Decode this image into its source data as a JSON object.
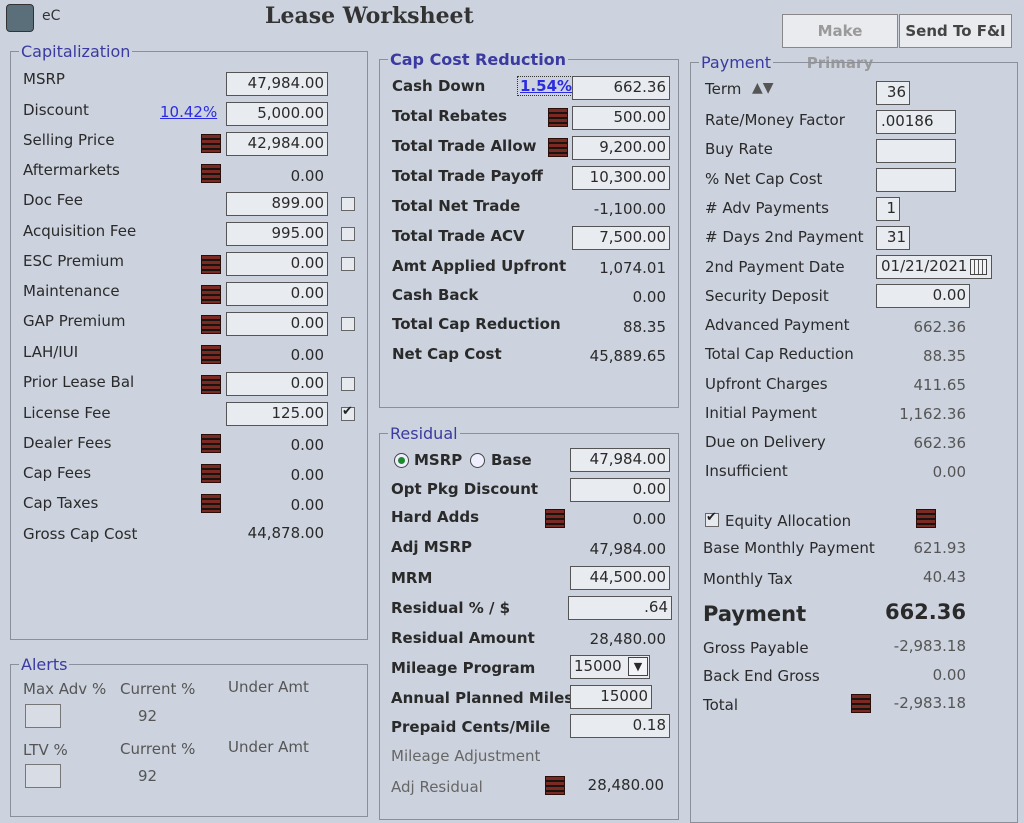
{
  "app": {
    "title": "Lease Worksheet",
    "brand": "eC"
  },
  "toolbar": {
    "make_primary": "Make Primary",
    "send_fi": "Send To F&I"
  },
  "capitalization": {
    "legend": "Capitalization",
    "msrp_label": "MSRP",
    "msrp": "47,984.00",
    "discount_label": "Discount",
    "discount_pct": "10.42%",
    "discount": "5,000.00",
    "selling_label": "Selling Price",
    "selling": "42,984.00",
    "aftermarkets_label": "Aftermarkets",
    "aftermarkets": "0.00",
    "docfee_label": "Doc Fee",
    "docfee": "899.00",
    "acqfee_label": "Acquisition Fee",
    "acqfee": "995.00",
    "esc_label": "ESC Premium",
    "esc": "0.00",
    "maint_label": "Maintenance",
    "maint": "0.00",
    "gap_label": "GAP Premium",
    "gap": "0.00",
    "lah_label": "LAH/IUI",
    "lah": "0.00",
    "prior_label": "Prior Lease Bal",
    "prior": "0.00",
    "license_label": "License Fee",
    "license": "125.00",
    "dealer_label": "Dealer Fees",
    "dealer": "0.00",
    "capfees_label": "Cap Fees",
    "capfees": "0.00",
    "captaxes_label": "Cap Taxes",
    "captaxes": "0.00",
    "gross_label": "Gross Cap Cost",
    "gross": "44,878.00"
  },
  "alerts": {
    "legend": "Alerts",
    "maxadv_label": "Max Adv %",
    "current_label": "Current %",
    "under_label": "Under Amt",
    "maxadv_current": "92",
    "ltv_label": "LTV %",
    "ltv_current_label": "Current %",
    "ltv_under_label": "Under Amt",
    "ltv_current": "92"
  },
  "capcost": {
    "legend": "Cap Cost Reduction",
    "cashdown_label": "Cash Down",
    "cashdown_pct": "1.54%",
    "cashdown": "662.36",
    "rebates_label": "Total Rebates",
    "rebates": "500.00",
    "tradeallow_label": "Total Trade Allow",
    "tradeallow": "9,200.00",
    "payoff_label": "Total Trade Payoff",
    "payoff": "10,300.00",
    "nettrade_label": "Total Net Trade",
    "nettrade": "-1,100.00",
    "acv_label": "Total Trade ACV",
    "acv": "7,500.00",
    "applied_label": "Amt Applied Upfront",
    "applied": "1,074.01",
    "cashback_label": "Cash Back",
    "cashback": "0.00",
    "totalred_label": "Total Cap Reduction",
    "totalred": "88.35",
    "netcap_label": "Net Cap Cost",
    "netcap": "45,889.65"
  },
  "residual": {
    "legend": "Residual",
    "msrp_radio": "MSRP",
    "base_radio": "Base",
    "msrp": "47,984.00",
    "optpkg_label": "Opt Pkg Discount",
    "optpkg": "0.00",
    "hardadds_label": "Hard Adds",
    "hardadds": "0.00",
    "adjmsrp_label": "Adj MSRP",
    "adjmsrp": "47,984.00",
    "mrm_label": "MRM",
    "mrm": "44,500.00",
    "respct_label": "Residual % / $",
    "respct": ".64",
    "resamt_label": "Residual Amount",
    "resamt": "28,480.00",
    "mileage_label": "Mileage Program",
    "mileage": "15000",
    "annual_label": "Annual Planned Miles",
    "annual": "15000",
    "prepaid_label": "Prepaid Cents/Mile",
    "prepaid": "0.18",
    "mileadj_label": "Mileage Adjustment",
    "adjres_label": "Adj Residual",
    "adjres": "28,480.00"
  },
  "payment": {
    "legend": "Payment",
    "term_label": "Term",
    "term": "36",
    "rate_label": "Rate/Money Factor",
    "rate": ".00186",
    "buyrate_label": "Buy Rate",
    "buyrate": "",
    "netcap_label": "% Net Cap Cost",
    "netcap": "",
    "adv_label": "# Adv Payments",
    "adv": "1",
    "days_label": "# Days 2nd Payment",
    "days": "31",
    "date_label": "2nd Payment Date",
    "date": "01/21/2021",
    "security_label": "Security Deposit",
    "security": "0.00",
    "advpay_label": "Advanced Payment",
    "advpay": "662.36",
    "capred_label": "Total Cap Reduction",
    "capred": "88.35",
    "upfront_label": "Upfront Charges",
    "upfront": "411.65",
    "initial_label": "Initial Payment",
    "initial": "1,162.36",
    "due_label": "Due on Delivery",
    "due": "662.36",
    "insuff_label": "Insufficient",
    "insuff": "0.00",
    "equity_label": "Equity Allocation",
    "base_label": "Base Monthly Payment",
    "base": "621.93",
    "tax_label": "Monthly Tax",
    "tax": "40.43",
    "payment_label": "Payment",
    "payment": "662.36",
    "grosspay_label": "Gross Payable",
    "grosspay": "-2,983.18",
    "backend_label": "Back End Gross",
    "backend": "0.00",
    "total_label": "Total",
    "total": "-2,983.18"
  }
}
